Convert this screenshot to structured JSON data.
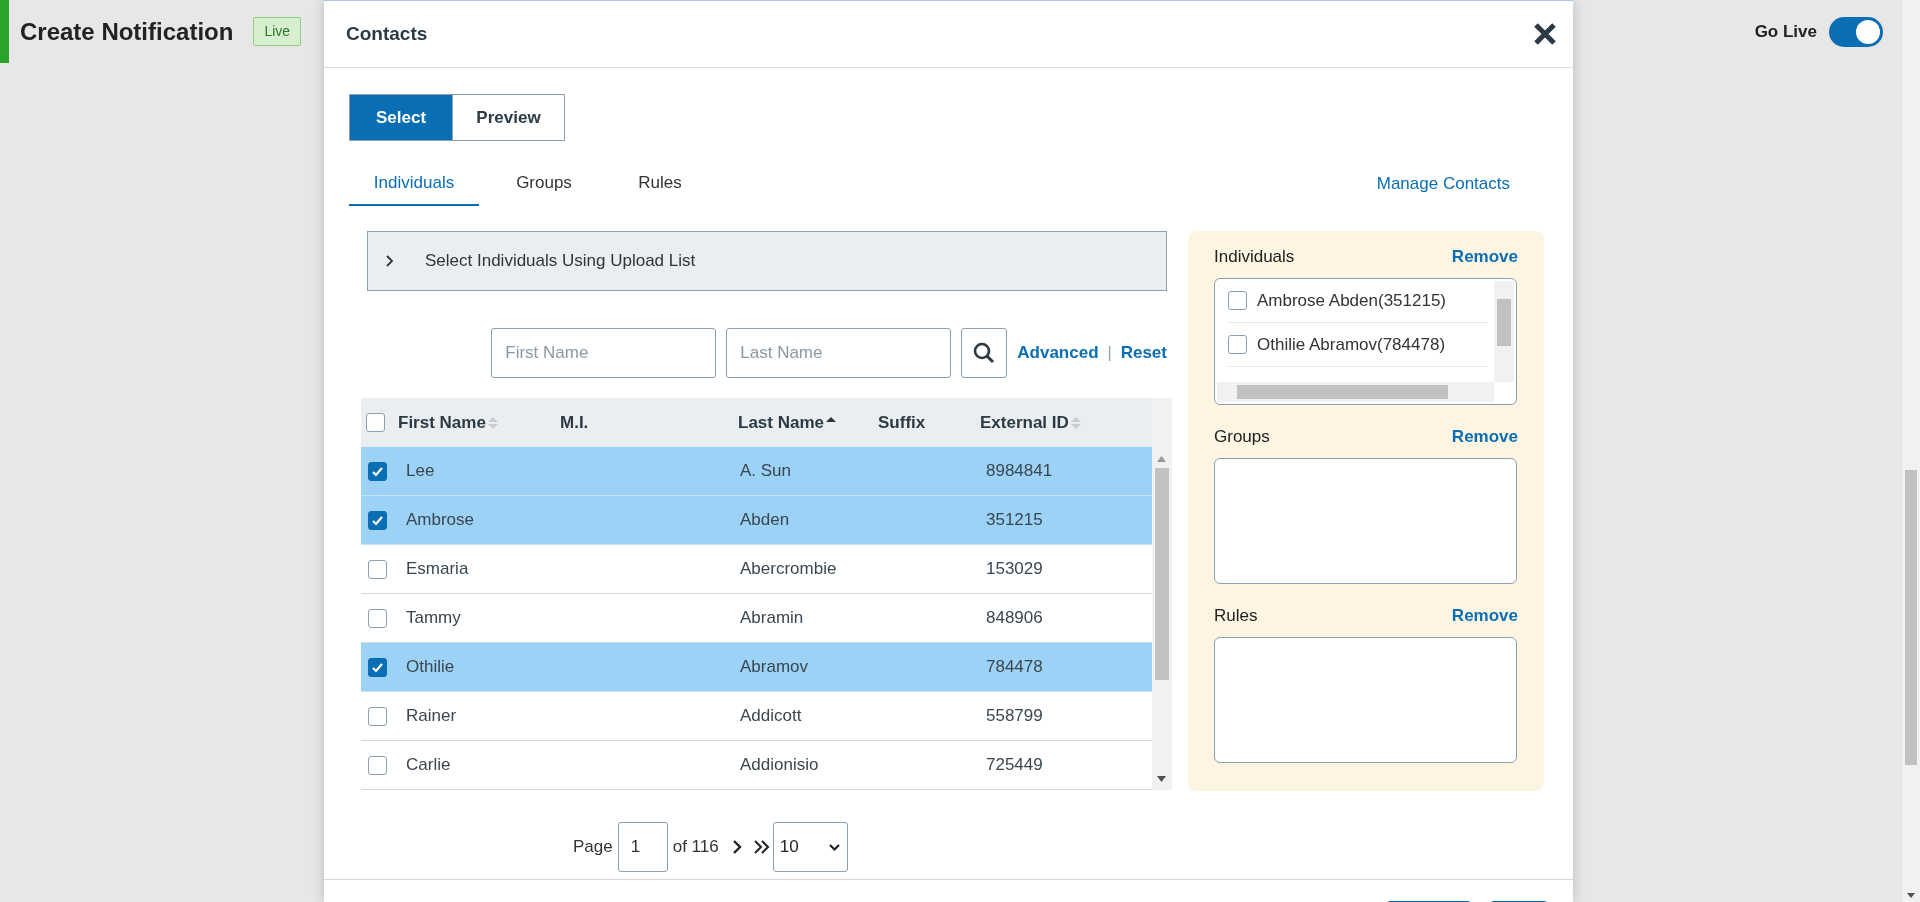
{
  "header": {
    "title": "Create Notification",
    "badge": "Live",
    "go_live": {
      "label": "Go Live",
      "on": true
    }
  },
  "dialog": {
    "title": "Contacts",
    "mode_tabs": [
      {
        "label": "Select",
        "selected": true
      },
      {
        "label": "Preview",
        "selected": false
      }
    ],
    "tabs": [
      {
        "label": "Individuals",
        "selected": true
      },
      {
        "label": "Groups",
        "selected": false
      },
      {
        "label": "Rules",
        "selected": false
      }
    ],
    "manage_link": "Manage Contacts",
    "upload_section": {
      "label": "Select Individuals Using Upload List",
      "expanded": false
    },
    "search": {
      "fields": [
        {
          "placeholder": "First Name"
        },
        {
          "placeholder": "Last Name"
        }
      ],
      "advanced": "Advanced",
      "separator": "|",
      "reset": "Reset"
    },
    "table": {
      "all_checked": false,
      "columns": [
        {
          "label": "First Name",
          "sortable": true,
          "sorted": false
        },
        {
          "label": "M.I."
        },
        {
          "label": "Last Name",
          "sortable": true,
          "sorted": true
        },
        {
          "label": "Suffix"
        },
        {
          "label": "External ID",
          "sortable": true,
          "sorted": false
        }
      ],
      "rows": [
        {
          "checked": true,
          "first_name": "Lee",
          "last_name": "A. Sun",
          "external_id": "8984841"
        },
        {
          "checked": true,
          "first_name": "Ambrose",
          "last_name": "Abden",
          "external_id": "351215"
        },
        {
          "checked": false,
          "first_name": "Esmaria",
          "last_name": "Abercrombie",
          "external_id": "153029"
        },
        {
          "checked": false,
          "first_name": "Tammy",
          "last_name": "Abramin",
          "external_id": "848906"
        },
        {
          "checked": true,
          "first_name": "Othilie",
          "last_name": "Abramov",
          "external_id": "784478"
        },
        {
          "checked": false,
          "first_name": "Rainer",
          "last_name": "Addicott",
          "external_id": "558799"
        },
        {
          "checked": false,
          "first_name": "Carlie",
          "last_name": "Addionisio",
          "external_id": "725449"
        }
      ]
    },
    "pagination": {
      "label": "Page",
      "page": "1",
      "total": "of 116",
      "page_size": "10"
    },
    "selection_panel": [
      {
        "title": "Individuals",
        "action": "Remove",
        "items": [
          {
            "label": "Ambrose Abden(351215)",
            "checked": false
          },
          {
            "label": "Othilie Abramov(784478)",
            "checked": false
          }
        ]
      },
      {
        "title": "Groups",
        "action": "Remove"
      },
      {
        "title": "Rules",
        "action": "Remove"
      }
    ]
  }
}
